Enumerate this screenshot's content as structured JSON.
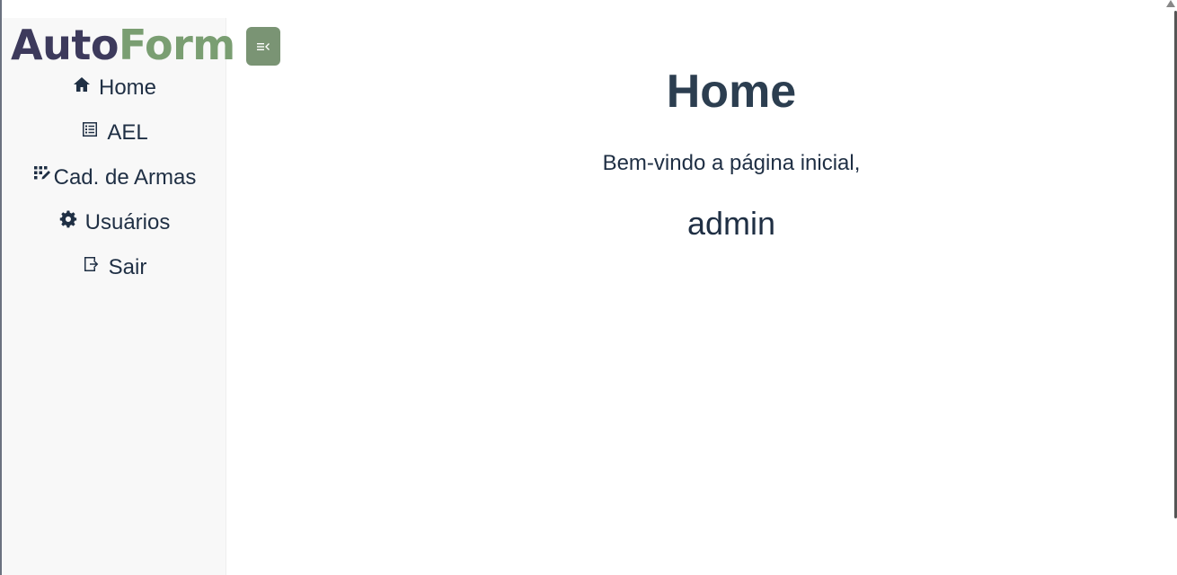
{
  "logo": {
    "part1": "Auto",
    "part2": "Form"
  },
  "sidebar": {
    "items": [
      {
        "label": "Home",
        "icon": "home-icon"
      },
      {
        "label": "AEL",
        "icon": "list-icon"
      },
      {
        "label": "Cad. de Armas",
        "icon": "grid-edit-icon"
      },
      {
        "label": "Usuários",
        "icon": "gear-icon"
      },
      {
        "label": "Sair",
        "icon": "logout-icon"
      }
    ]
  },
  "toggle": {
    "icon": "menu-collapse-icon"
  },
  "main": {
    "title": "Home",
    "welcome": "Bem-vindo a página inicial,",
    "username": "admin"
  },
  "colors": {
    "logo_dark": "#3d3a5c",
    "logo_accent": "#7a9e72",
    "toggle_bg": "#7a9474",
    "text": "#2c3e50"
  }
}
